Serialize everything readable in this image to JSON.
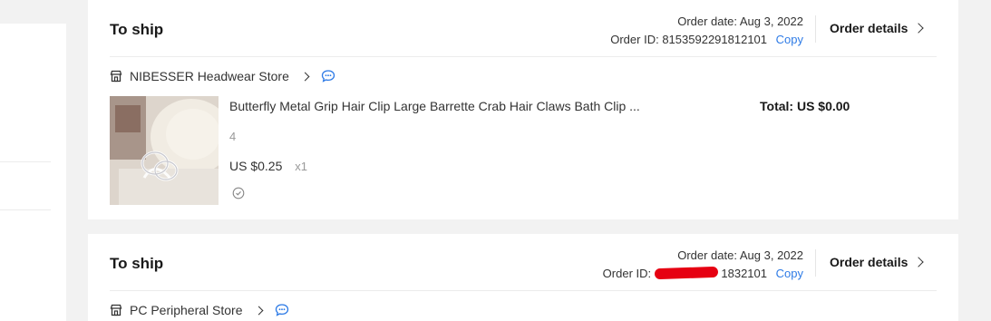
{
  "orders": [
    {
      "status": "To ship",
      "order_date": "Order date: Aug 3, 2022",
      "order_id_label": "Order ID:",
      "order_id": "8153592291812101",
      "copy_label": "Copy",
      "details_label": "Order details",
      "store_name": "NIBESSER Headwear Store",
      "product_title": "Butterfly Metal Grip Hair Clip Large Barrette Crab Hair Claws Bath Clip ...",
      "variant": "4",
      "price": "US $0.25",
      "quantity": "x1",
      "total": "Total: US $0.00"
    },
    {
      "status": "To ship",
      "order_date": "Order date: Aug 3, 2022",
      "order_id_label": "Order ID:",
      "order_id_tail": "1832101",
      "copy_label": "Copy",
      "details_label": "Order details",
      "store_name": "PC Peripheral Store"
    }
  ],
  "icons": {
    "store": "store-icon",
    "chat": "chat-icon",
    "chevron": "chevron-right-icon",
    "protection": "shield-icon"
  },
  "colors": {
    "accent_link": "#2e7be6",
    "redaction": "#e60012"
  }
}
